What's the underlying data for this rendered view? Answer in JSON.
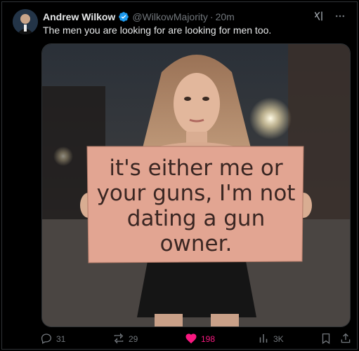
{
  "author": {
    "name": "Andrew Wilkow",
    "handle": "@WilkowMajority",
    "separator": "·",
    "time": "20m"
  },
  "tweet": {
    "text": "The men you are looking for are looking for men too."
  },
  "media": {
    "sign_lines": [
      "it's either me or",
      "your guns, I'm not",
      "dating a gun",
      "owner."
    ]
  },
  "actions": {
    "replies": "31",
    "reposts": "29",
    "likes": "198",
    "views": "3K"
  },
  "colors": {
    "background": "#000000",
    "text": "#e7e9ea",
    "muted": "#71767b",
    "verified": "#1d9bf0",
    "like_active": "#f91880"
  },
  "icons": [
    "grok-icon",
    "more-icon",
    "reply-icon",
    "repost-icon",
    "heart-icon",
    "views-icon",
    "bookmark-icon",
    "share-icon",
    "verified-badge-icon"
  ]
}
